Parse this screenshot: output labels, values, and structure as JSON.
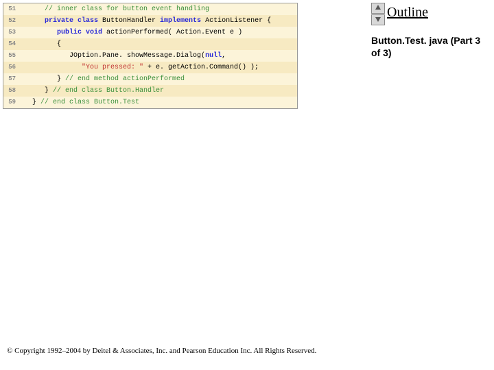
{
  "outline": {
    "title": "Outline",
    "file_label": "Button.Test. java (Part 3 of 3)"
  },
  "code": {
    "lines": [
      {
        "num": "51",
        "indent": "      ",
        "tokens": [
          {
            "cls": "cmt",
            "text": "// inner class for button event handling"
          }
        ]
      },
      {
        "num": "52",
        "indent": "      ",
        "tokens": [
          {
            "cls": "kw",
            "text": "private class"
          },
          {
            "cls": "pln",
            "text": " ButtonHandler "
          },
          {
            "cls": "kw",
            "text": "implements"
          },
          {
            "cls": "pln",
            "text": " ActionListener {"
          }
        ]
      },
      {
        "num": "53",
        "indent": "         ",
        "tokens": [
          {
            "cls": "kw",
            "text": "public void"
          },
          {
            "cls": "pln",
            "text": " actionPerformed( Action.Event e )"
          }
        ]
      },
      {
        "num": "54",
        "indent": "         ",
        "tokens": [
          {
            "cls": "pln",
            "text": "{"
          }
        ]
      },
      {
        "num": "55",
        "indent": "            ",
        "tokens": [
          {
            "cls": "pln",
            "text": "JOption.Pane. showMessage.Dialog("
          },
          {
            "cls": "kw",
            "text": "null"
          },
          {
            "cls": "pln",
            "text": ","
          }
        ]
      },
      {
        "num": "56",
        "indent": "               ",
        "tokens": [
          {
            "cls": "str",
            "text": "\"You pressed: \""
          },
          {
            "cls": "pln",
            "text": " + e. getAction.Command() );"
          }
        ]
      },
      {
        "num": "57",
        "indent": "         ",
        "tokens": [
          {
            "cls": "pln",
            "text": "} "
          },
          {
            "cls": "cmt",
            "text": "// end method actionPerformed"
          }
        ]
      },
      {
        "num": "58",
        "indent": "      ",
        "tokens": [
          {
            "cls": "pln",
            "text": "} "
          },
          {
            "cls": "cmt",
            "text": "// end class Button.Handler"
          }
        ]
      },
      {
        "num": "59",
        "indent": "   ",
        "tokens": [
          {
            "cls": "pln",
            "text": "} "
          },
          {
            "cls": "cmt",
            "text": "// end class Button.Test"
          }
        ]
      }
    ]
  },
  "copyright": "© Copyright 1992–2004 by Deitel & Associates, Inc. and Pearson Education Inc. All Rights Reserved."
}
